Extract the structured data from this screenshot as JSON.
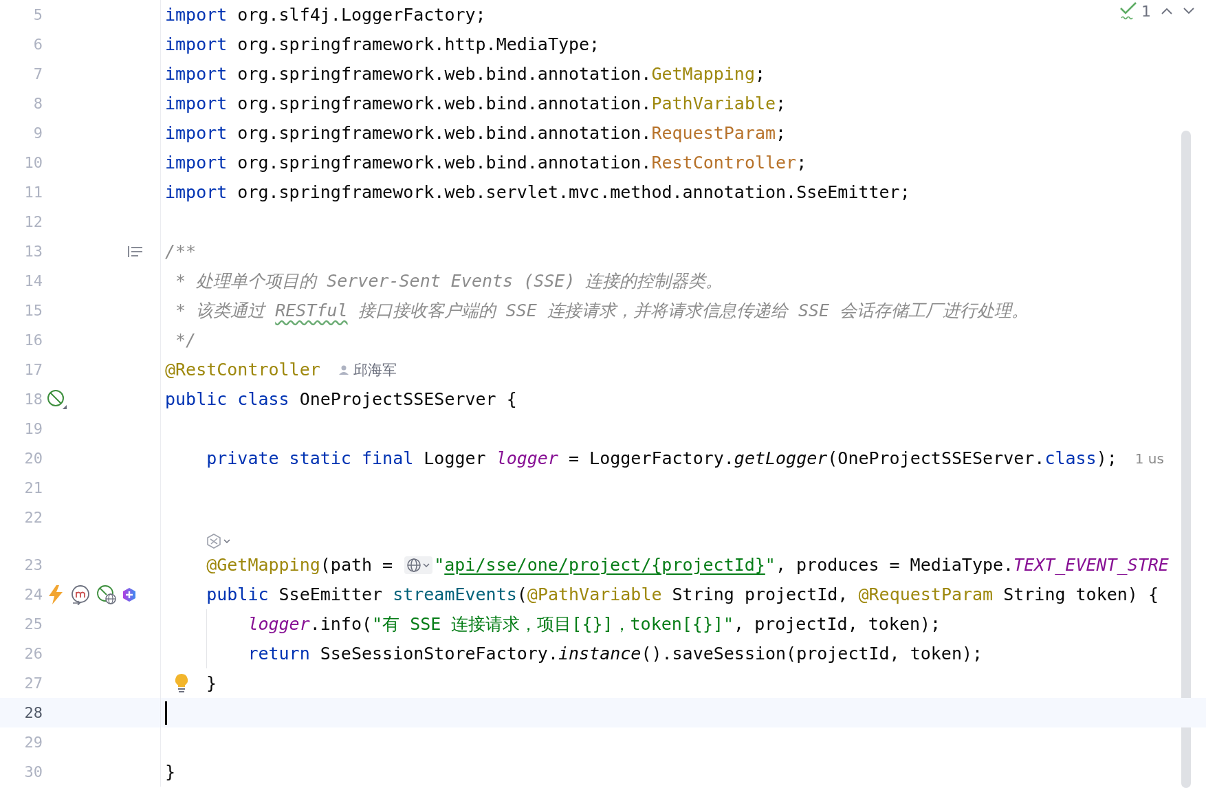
{
  "inspections": {
    "count": "1"
  },
  "lines": [
    {
      "number": "5",
      "current": false,
      "tokens": [
        {
          "kind": "kw",
          "text": "import"
        },
        {
          "kind": "plain",
          "text": " org.slf4j.LoggerFactory;"
        }
      ]
    },
    {
      "number": "6",
      "current": false,
      "tokens": [
        {
          "kind": "kw",
          "text": "import"
        },
        {
          "kind": "plain",
          "text": " org.springframework.http.MediaType;"
        }
      ]
    },
    {
      "number": "7",
      "current": false,
      "tokens": [
        {
          "kind": "kw",
          "text": "import"
        },
        {
          "kind": "plain",
          "text": " org.springframework.web.bind.annotation."
        },
        {
          "kind": "ann",
          "text": "GetMapping"
        },
        {
          "kind": "plain",
          "text": ";"
        }
      ]
    },
    {
      "number": "8",
      "current": false,
      "tokens": [
        {
          "kind": "kw",
          "text": "import"
        },
        {
          "kind": "plain",
          "text": " org.springframework.web.bind.annotation."
        },
        {
          "kind": "ann",
          "text": "PathVariable"
        },
        {
          "kind": "plain",
          "text": ";"
        }
      ]
    },
    {
      "number": "9",
      "current": false,
      "tokens": [
        {
          "kind": "kw",
          "text": "import"
        },
        {
          "kind": "plain",
          "text": " org.springframework.web.bind.annotation."
        },
        {
          "kind": "ann_alt",
          "text": "RequestParam"
        },
        {
          "kind": "plain",
          "text": ";"
        }
      ]
    },
    {
      "number": "10",
      "current": false,
      "tokens": [
        {
          "kind": "kw",
          "text": "import"
        },
        {
          "kind": "plain",
          "text": " org.springframework.web.bind.annotation."
        },
        {
          "kind": "ann_alt",
          "text": "RestController"
        },
        {
          "kind": "plain",
          "text": ";"
        }
      ]
    },
    {
      "number": "11",
      "current": false,
      "tokens": [
        {
          "kind": "kw",
          "text": "import"
        },
        {
          "kind": "plain",
          "text": " org.springframework.web.servlet.mvc.method.annotation.SseEmitter;"
        }
      ]
    },
    {
      "number": "12",
      "current": false
    },
    {
      "number": "13",
      "current": false,
      "tokens": [
        {
          "kind": "comment",
          "text": "/**"
        }
      ]
    },
    {
      "number": "14",
      "current": false,
      "tokens": [
        {
          "kind": "comment",
          "text": " * 处理单个项目的 Server-Sent Events (SSE) 连接的控制器类。"
        }
      ]
    },
    {
      "number": "15",
      "current": false,
      "tokens": [
        {
          "kind": "comment",
          "text": " * 该类通过 "
        },
        {
          "kind": "typo",
          "text": "RESTful"
        },
        {
          "kind": "comment",
          "text": " 接口接收客户端的 SSE 连接请求，并将请求信息传递给 SSE 会话存储工厂进行处理。"
        }
      ]
    },
    {
      "number": "16",
      "current": false,
      "tokens": [
        {
          "kind": "comment",
          "text": " */"
        }
      ]
    },
    {
      "number": "17",
      "current": false,
      "tokens": [
        {
          "kind": "ann",
          "text": "@RestController"
        },
        {
          "kind": "author",
          "text": "邱海军"
        }
      ]
    },
    {
      "number": "18",
      "current": false,
      "tokens": [
        {
          "kind": "kw",
          "text": "public class"
        },
        {
          "kind": "plain",
          "text": " OneProjectSSEServer {"
        }
      ]
    },
    {
      "number": "19",
      "current": false
    },
    {
      "number": "20",
      "current": false,
      "tokens": [
        {
          "kind": "kw",
          "text": "    private static final"
        },
        {
          "kind": "plain",
          "text": " Logger "
        },
        {
          "kind": "field",
          "text": "logger"
        },
        {
          "kind": "plain",
          "text": " = LoggerFactory."
        },
        {
          "kind": "italic",
          "text": "getLogger"
        },
        {
          "kind": "plain",
          "text": "(OneProjectSSEServer."
        },
        {
          "kind": "kw",
          "text": "class"
        },
        {
          "kind": "plain",
          "text": ");"
        },
        {
          "kind": "hint",
          "text": "1 us"
        }
      ]
    },
    {
      "number": "21",
      "current": false
    },
    {
      "number": "22",
      "current": false
    },
    {
      "kind": "inlay",
      "current": false
    },
    {
      "number": "23",
      "current": false,
      "tokens": [
        {
          "kind": "ann",
          "text": "    @GetMapping"
        },
        {
          "kind": "plain",
          "text": "(path = "
        },
        {
          "kind": "str_open",
          "text": "\""
        },
        {
          "kind": "url",
          "text": "api/sse/one/project/{projectId}"
        },
        {
          "kind": "str",
          "text": "\""
        },
        {
          "kind": "plain",
          "text": ", produces = MediaType."
        },
        {
          "kind": "const",
          "text": "TEXT_EVENT_STRE"
        }
      ]
    },
    {
      "number": "24",
      "current": false,
      "tokens": [
        {
          "kind": "kw",
          "text": "    public"
        },
        {
          "kind": "plain",
          "text": " SseEmitter "
        },
        {
          "kind": "method",
          "text": "streamEvents"
        },
        {
          "kind": "plain",
          "text": "("
        },
        {
          "kind": "ann",
          "text": "@PathVariable"
        },
        {
          "kind": "plain",
          "text": " String projectId, "
        },
        {
          "kind": "ann",
          "text": "@RequestParam"
        },
        {
          "kind": "plain",
          "text": " String token) {"
        }
      ]
    },
    {
      "number": "25",
      "current": false,
      "tokens": [
        {
          "kind": "field",
          "text": "        logger"
        },
        {
          "kind": "plain",
          "text": ".info("
        },
        {
          "kind": "str",
          "text": "\"有 SSE 连接请求，项目[{}]，token[{}]\""
        },
        {
          "kind": "plain",
          "text": ", projectId, token);"
        }
      ]
    },
    {
      "number": "26",
      "current": false,
      "tokens": [
        {
          "kind": "kw",
          "text": "        return"
        },
        {
          "kind": "plain",
          "text": " SseSessionStoreFactory."
        },
        {
          "kind": "italic",
          "text": "instance"
        },
        {
          "kind": "plain",
          "text": "().saveSession(projectId, token);"
        }
      ]
    },
    {
      "number": "27",
      "current": false,
      "tokens": [
        {
          "kind": "plain",
          "text": "}"
        }
      ]
    },
    {
      "number": "28",
      "current": true
    },
    {
      "number": "29",
      "current": false
    },
    {
      "number": "30",
      "current": false,
      "tokens": [
        {
          "kind": "plain",
          "text": "}"
        }
      ]
    }
  ]
}
